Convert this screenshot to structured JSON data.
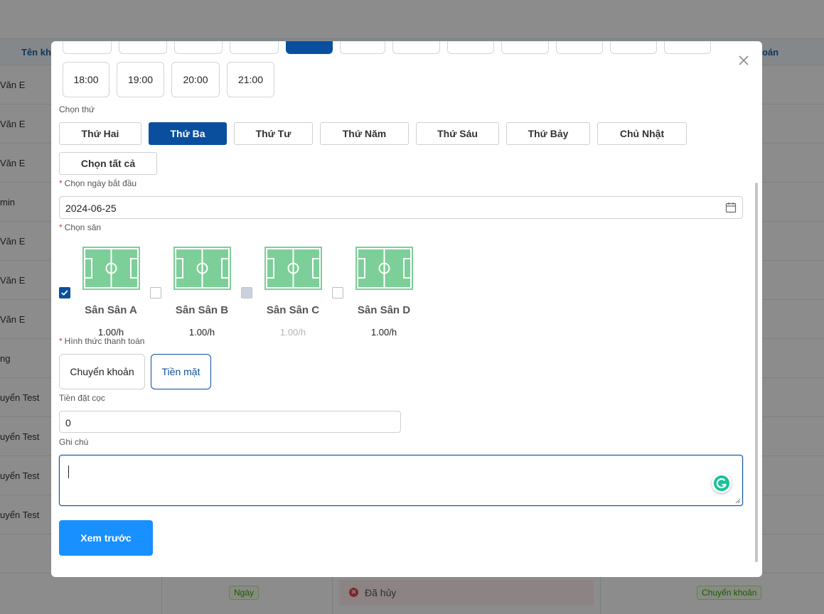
{
  "background": {
    "columns": {
      "name": "Tên kh",
      "payment": "oán"
    },
    "rows": [
      "Văn E",
      "Văn E",
      "Văn E",
      "min",
      "Văn E",
      "Văn E",
      "Văn E",
      "ng",
      "uyển Test",
      "uyển Test",
      "uyển Test",
      "uyển Test"
    ],
    "last_row": {
      "type_tag": "Ngày",
      "status": "Đã hủy",
      "payment_tag": "Chuyển khoản"
    }
  },
  "modal": {
    "time_slots_top_row_count": 12,
    "time_slots": [
      "18:00",
      "19:00",
      "20:00",
      "21:00"
    ],
    "days_label": "Chọn thứ",
    "days": [
      "Thứ Hai",
      "Thứ Ba",
      "Thứ Tư",
      "Thứ Năm",
      "Thứ Sáu",
      "Thứ Bảy",
      "Chủ Nhật"
    ],
    "active_day": "Thứ Ba",
    "select_all": "Chọn tất cả",
    "start_date_label": "Chọn ngày bắt đầu",
    "start_date_value": "2024-06-25",
    "court_label": "Chọn sân",
    "courts": [
      {
        "name": "Sân Sân A",
        "price": "1.00/h",
        "state": "checked"
      },
      {
        "name": "Sân Sân B",
        "price": "1.00/h",
        "state": "unchecked"
      },
      {
        "name": "Sân Sân C",
        "price": "1.00/h",
        "state": "disabled"
      },
      {
        "name": "Sân Sân D",
        "price": "1.00/h",
        "state": "unchecked"
      }
    ],
    "payment_label": "Hình thức thanh toán",
    "payment_methods": [
      "Chuyển khoản",
      "Tiền mặt"
    ],
    "active_payment": "Tiền mặt",
    "deposit_label": "Tiền đặt cọc",
    "deposit_value": "0",
    "note_label": "Ghi chú",
    "note_value": "",
    "preview_button": "Xem trước"
  },
  "colors": {
    "primary": "#0a4f9e",
    "preview": "#1890ff",
    "court_green": "#7ccf98",
    "required": "#e03131"
  }
}
